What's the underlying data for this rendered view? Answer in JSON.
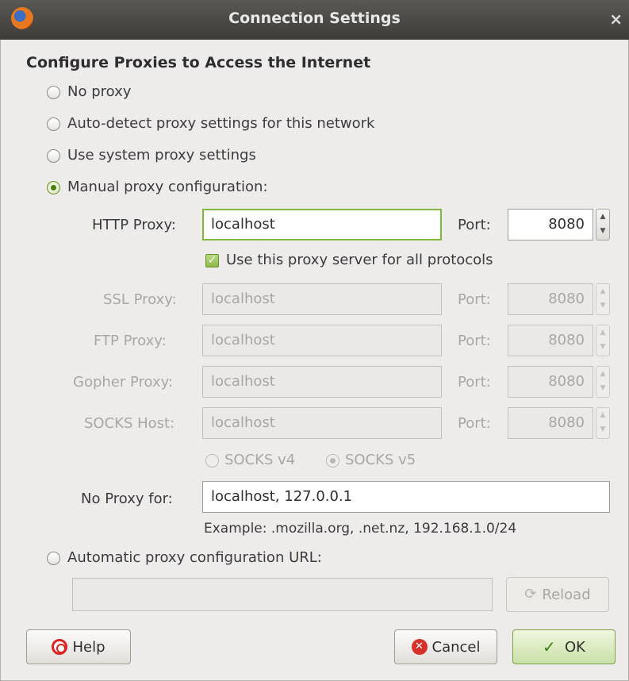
{
  "window": {
    "title": "Connection Settings",
    "close_glyph": "×",
    "app_icon": "firefox-icon"
  },
  "heading": "Configure Proxies to Access the Internet",
  "proxy_modes": [
    {
      "label": "No proxy",
      "checked": false
    },
    {
      "label": "Auto-detect proxy settings for this network",
      "checked": false
    },
    {
      "label": "Use system proxy settings",
      "checked": false
    },
    {
      "label": "Manual proxy configuration:",
      "checked": true
    }
  ],
  "manual": {
    "http": {
      "label": "HTTP Proxy:",
      "value": "localhost",
      "port_label": "Port:",
      "port": "8080"
    },
    "use_for_all": {
      "label": "Use this proxy server for all protocols",
      "checked": true
    },
    "ssl": {
      "label": "SSL Proxy:",
      "value": "localhost",
      "port_label": "Port:",
      "port": "8080"
    },
    "ftp": {
      "label": "FTP Proxy:",
      "value": "localhost",
      "port_label": "Port:",
      "port": "8080"
    },
    "gopher": {
      "label": "Gopher Proxy:",
      "value": "localhost",
      "port_label": "Port:",
      "port": "8080"
    },
    "socks": {
      "label": "SOCKS Host:",
      "value": "localhost",
      "port_label": "Port:",
      "port": "8080"
    },
    "socks_v4": {
      "label": "SOCKS v4",
      "checked": false
    },
    "socks_v5": {
      "label": "SOCKS v5",
      "checked": true
    },
    "no_proxy": {
      "label": "No Proxy for:",
      "value": "localhost, 127.0.0.1"
    },
    "example": "Example: .mozilla.org, .net.nz, 192.168.1.0/24"
  },
  "auto_config": {
    "label": "Automatic proxy configuration URL:",
    "value": "",
    "reload_label": "Reload",
    "checked": false
  },
  "buttons": {
    "help": "Help",
    "cancel": "Cancel",
    "ok": "OK"
  }
}
